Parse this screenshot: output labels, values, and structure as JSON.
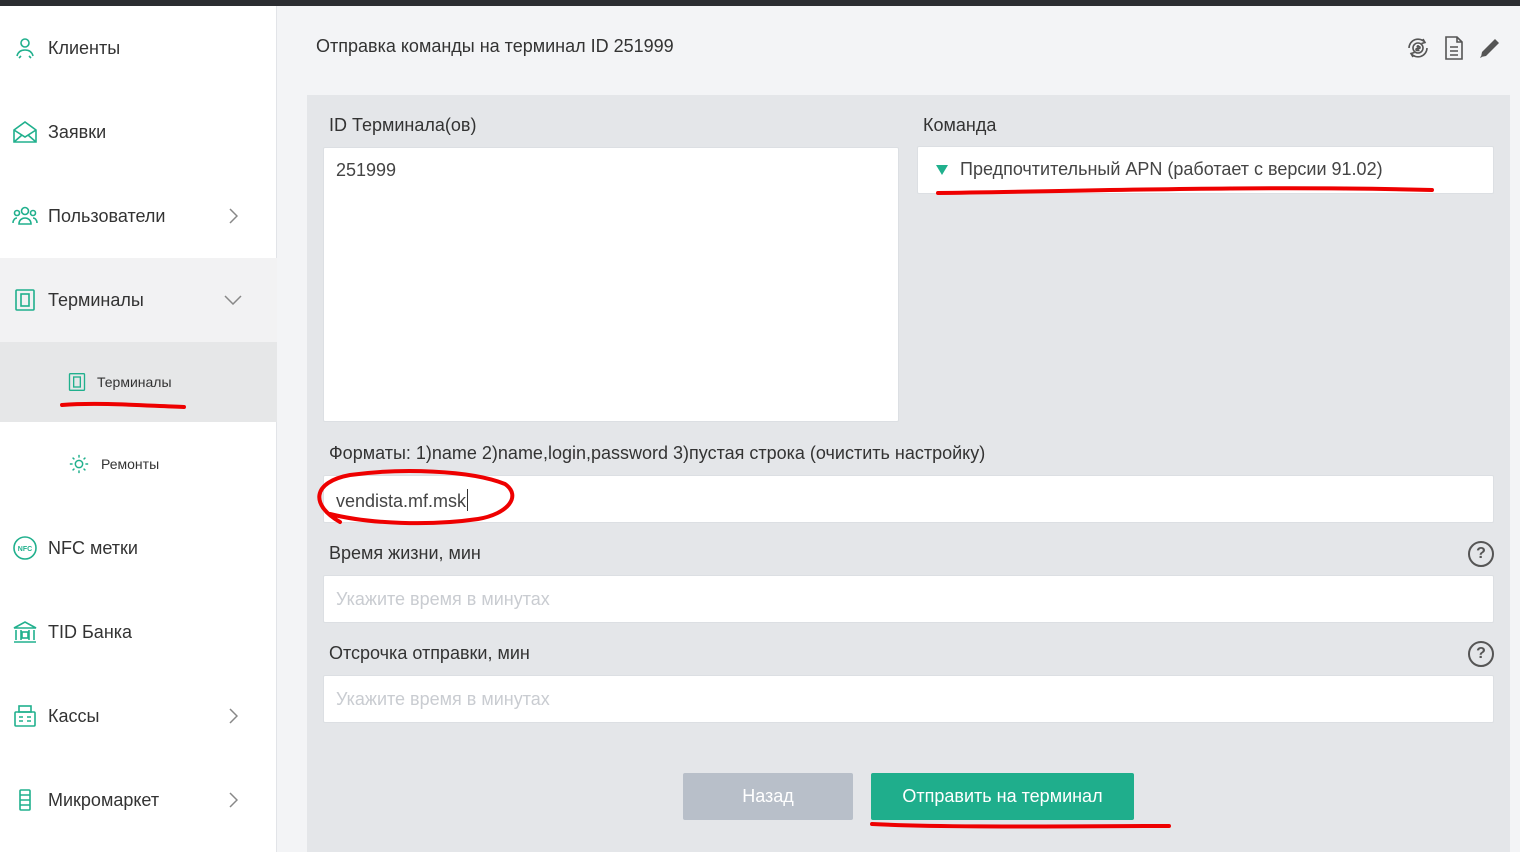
{
  "sidebar": {
    "items": [
      {
        "label": "Клиенты",
        "icon": "clients-icon"
      },
      {
        "label": "Заявки",
        "icon": "envelope-icon"
      },
      {
        "label": "Пользователи",
        "icon": "users-icon"
      },
      {
        "label": "Терминалы",
        "icon": "terminal-icon"
      },
      {
        "label": "NFC метки",
        "icon": "nfc-icon"
      },
      {
        "label": "TID Банка",
        "icon": "bank-icon"
      },
      {
        "label": "Кассы",
        "icon": "cash-register-icon"
      },
      {
        "label": "Микромаркет",
        "icon": "micromarket-icon"
      }
    ],
    "subitems": [
      {
        "label": "Терминалы",
        "icon": "terminal-icon"
      },
      {
        "label": "Ремонты",
        "icon": "repairs-gear-icon"
      }
    ],
    "nfc_icon_text": "NFC"
  },
  "header": {
    "title": "Отправка команды на терминал ID 251999",
    "icons": [
      "money-sync-icon",
      "document-icon",
      "pencil-icon"
    ]
  },
  "form": {
    "terminal_ids_label": "ID Терминала(ов)",
    "terminal_ids_value": "251999",
    "command_label": "Команда",
    "command_value": "Предпочтительный APN (работает с версии 91.02)",
    "formats_label": "Форматы: 1)name 2)name,login,password 3)пустая строка (очистить настройку)",
    "formats_value": "vendista.mf.msk",
    "lifetime_label": "Время жизни, мин",
    "lifetime_placeholder": "Укажите время в минутах",
    "delay_label": "Отсрочка отправки, мин",
    "delay_placeholder": "Укажите время в минутах",
    "help_glyph": "?"
  },
  "buttons": {
    "back": "Назад",
    "send": "Отправить на терминал"
  },
  "colors": {
    "accent": "#1fae8c",
    "icon_green": "#20b08d",
    "button_disabled": "#b8bfc9",
    "annotation_red": "#ee0000"
  }
}
